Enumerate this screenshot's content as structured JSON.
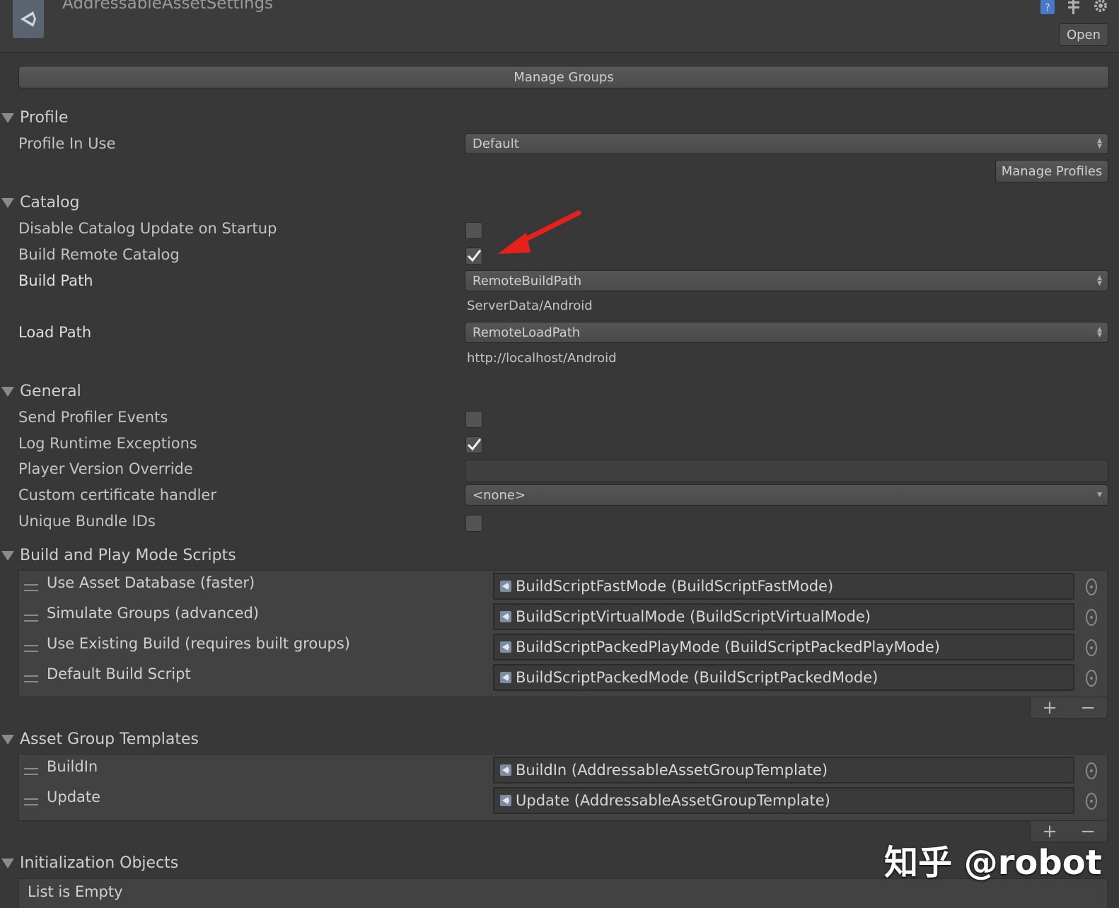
{
  "window": {
    "title": "AddressableAssetSettings",
    "open_label": "Open",
    "manage_groups_label": "Manage Groups"
  },
  "profile": {
    "section": "Profile",
    "profile_in_use_label": "Profile In Use",
    "profile_value": "Default",
    "manage_profiles_label": "Manage Profiles"
  },
  "catalog": {
    "section": "Catalog",
    "disable_update_label": "Disable Catalog Update on Startup",
    "disable_update_checked": false,
    "build_remote_label": "Build Remote Catalog",
    "build_remote_checked": true,
    "build_path_label": "Build Path",
    "build_path_value": "RemoteBuildPath",
    "build_path_resolved": "ServerData/Android",
    "load_path_label": "Load Path",
    "load_path_value": "RemoteLoadPath",
    "load_path_resolved": "http://localhost/Android"
  },
  "general": {
    "section": "General",
    "send_profiler_label": "Send Profiler Events",
    "send_profiler_checked": false,
    "log_runtime_label": "Log Runtime Exceptions",
    "log_runtime_checked": true,
    "player_version_label": "Player Version Override",
    "player_version_value": "",
    "cert_handler_label": "Custom certificate handler",
    "cert_handler_value": "<none>",
    "unique_ids_label": "Unique Bundle IDs",
    "unique_ids_checked": false
  },
  "build_play_scripts": {
    "section": "Build and Play Mode Scripts",
    "items": [
      {
        "label": "Use Asset Database (faster)",
        "value": "BuildScriptFastMode (BuildScriptFastMode)"
      },
      {
        "label": "Simulate Groups (advanced)",
        "value": "BuildScriptVirtualMode (BuildScriptVirtualMode)"
      },
      {
        "label": "Use Existing Build (requires built groups)",
        "value": "BuildScriptPackedPlayMode (BuildScriptPackedPlayMode)"
      },
      {
        "label": "Default Build Script",
        "value": "BuildScriptPackedMode (BuildScriptPackedMode)"
      }
    ]
  },
  "group_templates": {
    "section": "Asset Group Templates",
    "items": [
      {
        "label": "BuildIn",
        "value": "BuildIn (AddressableAssetGroupTemplate)"
      },
      {
        "label": "Update",
        "value": "Update (AddressableAssetGroupTemplate)"
      }
    ]
  },
  "init_objects": {
    "section": "Initialization Objects",
    "empty_text": "List is Empty"
  },
  "list_controls": {
    "add": "+",
    "remove": "−"
  },
  "watermark": "知乎 @robot",
  "colors": {
    "background": "#383838",
    "arrow": "#e8201c",
    "accent_icon": "#4a7ac7"
  }
}
